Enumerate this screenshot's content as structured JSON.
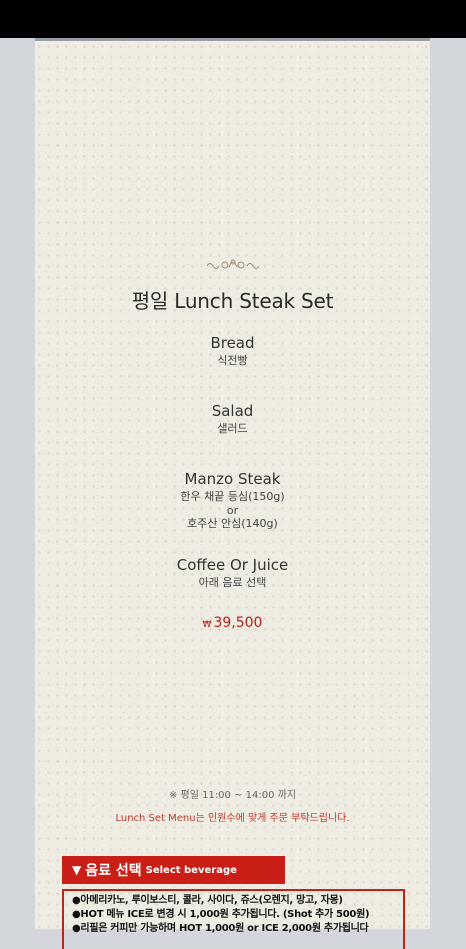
{
  "menu": {
    "title": "평일 Lunch Steak Set",
    "courses": [
      {
        "en": "Bread",
        "ko": "식전빵"
      },
      {
        "en": "Salad",
        "ko": "샐러드"
      },
      {
        "en": "Manzo Steak",
        "ko": "한우 채끝 등심(150g)",
        "or": "or",
        "ko2": "호주산 안심(140g)"
      },
      {
        "en": "Coffee Or Juice",
        "ko": "아래 음료 선택"
      }
    ],
    "price_symbol": "₩",
    "price": "39,500",
    "hours": "※ 평일 11:00 ~ 14:00 까지",
    "notice": "Lunch Set Menu는 인원수에 맞게 주문 부탁드립니다."
  },
  "beverage": {
    "arrow": "▼",
    "title_ko": "음료 선택",
    "title_en": "Select beverage",
    "lines": [
      "●아메리카노, 루이보스티, 콜라, 사이다, 쥬스(오렌지, 망고, 자몽)",
      "●HOT 메뉴 ICE로 변경 시 1,000원 추가됩니다. (Shot 추가 500원)",
      "●리필은 커피만 가능하며 HOT 1,000원 or ICE 2,000원 추가됩니다"
    ]
  },
  "colors": {
    "accent": "#c91f17",
    "background": "#efede3"
  },
  "icons": {
    "ornament": "flourish-ornament-icon"
  }
}
